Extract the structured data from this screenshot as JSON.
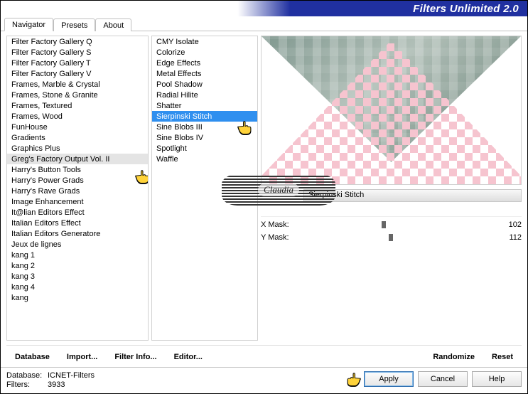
{
  "title": "Filters Unlimited 2.0",
  "tabs": [
    "Navigator",
    "Presets",
    "About"
  ],
  "active_tab": 0,
  "categories": [
    "Filter Factory Gallery Q",
    "Filter Factory Gallery S",
    "Filter Factory Gallery T",
    "Filter Factory Gallery V",
    "Frames, Marble & Crystal",
    "Frames, Stone & Granite",
    "Frames, Textured",
    "Frames, Wood",
    "FunHouse",
    "Gradients",
    "Graphics Plus",
    "Greg's Factory Output Vol. II",
    "Harry's Button Tools",
    "Harry's Power Grads",
    "Harry's Rave Grads",
    "Image Enhancement",
    "It@lian Editors Effect",
    "Italian Editors Effect",
    "Italian Editors Generatore",
    "Jeux de lignes",
    "kang 1",
    "kang 2",
    "kang 3",
    "kang 4",
    "kang"
  ],
  "selected_category_index": 11,
  "filters": [
    "CMY Isolate",
    "Colorize",
    "Edge Effects",
    "Metal Effects",
    "Pool Shadow",
    "Radial Hilite",
    "Shatter",
    "Sierpinski Stitch",
    "Sine Blobs III",
    "Sine Blobs IV",
    "Spotlight",
    "Waffle"
  ],
  "selected_filter_index": 7,
  "watermark_text": "Claudia",
  "filter_name": "Sierpinski Stitch",
  "params": [
    {
      "label": "X Mask:",
      "value": "102",
      "pos": 40
    },
    {
      "label": "Y Mask:",
      "value": "112",
      "pos": 44
    }
  ],
  "toolbar": {
    "database": "Database",
    "import": "Import...",
    "filter_info": "Filter Info...",
    "editor": "Editor...",
    "randomize": "Randomize",
    "reset": "Reset"
  },
  "footer": {
    "db_label": "Database:",
    "db_value": "ICNET-Filters",
    "filters_label": "Filters:",
    "filters_value": "3933",
    "apply": "Apply",
    "cancel": "Cancel",
    "help": "Help"
  }
}
